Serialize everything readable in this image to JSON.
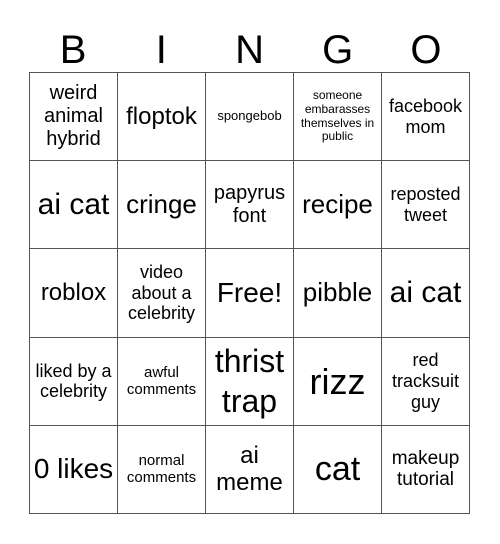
{
  "header": [
    "B",
    "I",
    "N",
    "G",
    "O"
  ],
  "cells": [
    "weird animal hybrid",
    "floptok",
    "spongebob",
    "someone embarasses themselves in public",
    "facebook mom",
    "ai cat",
    "cringe",
    "papyrus font",
    "recipe",
    "reposted tweet",
    "roblox",
    "video about a celebrity",
    "Free!",
    "pibble",
    "ai cat",
    "liked by a celebrity",
    "awful comments",
    "thrist trap",
    "rizz",
    "red tracksuit guy",
    "0 likes",
    "normal comments",
    "ai meme",
    "cat",
    "makeup tutorial"
  ]
}
